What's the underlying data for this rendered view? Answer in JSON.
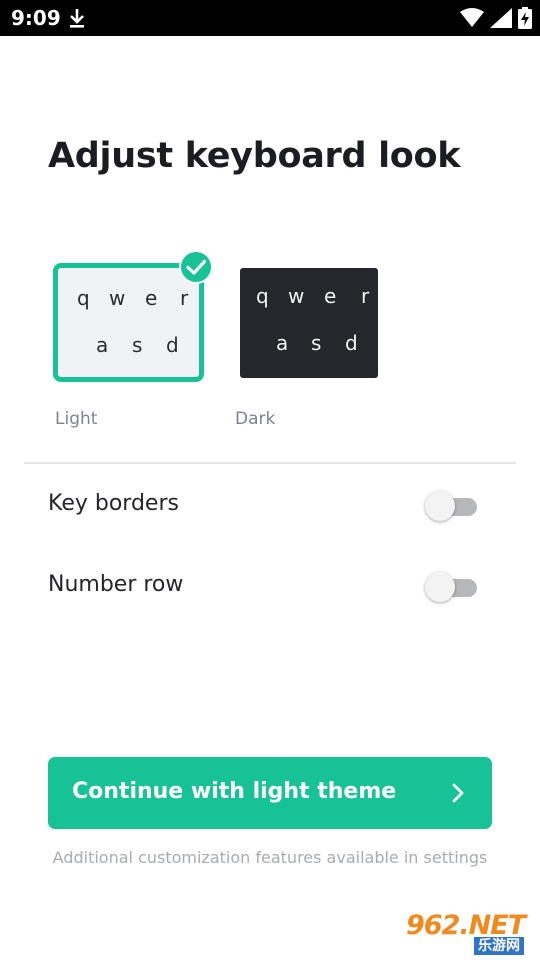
{
  "status_bar": {
    "time": "9:09",
    "icons": [
      "download-icon",
      "wifi-icon",
      "signal-icon",
      "battery-charging-icon"
    ]
  },
  "title": "Adjust keyboard look",
  "themes": {
    "light": {
      "label": "Light",
      "selected": true,
      "keys_row1": [
        "q",
        "w",
        "e",
        "r"
      ],
      "keys_row2": [
        "a",
        "s",
        "d"
      ],
      "background": "#f1f2f5",
      "border": "#18c297"
    },
    "dark": {
      "label": "Dark",
      "selected": false,
      "keys_row1": [
        "q",
        "w",
        "e",
        "r"
      ],
      "keys_row2": [
        "a",
        "s",
        "d"
      ],
      "background": "#26272c"
    }
  },
  "settings": [
    {
      "label": "Key borders",
      "enabled": false
    },
    {
      "label": "Number row",
      "enabled": false
    }
  ],
  "continue_button": {
    "label": "Continue with light theme",
    "icon": "chevron-right-icon",
    "color": "#18c297"
  },
  "footer_note": "Additional customization features available in settings",
  "watermark": {
    "logo_text": "962.NET",
    "sub_text": "乐游网"
  }
}
